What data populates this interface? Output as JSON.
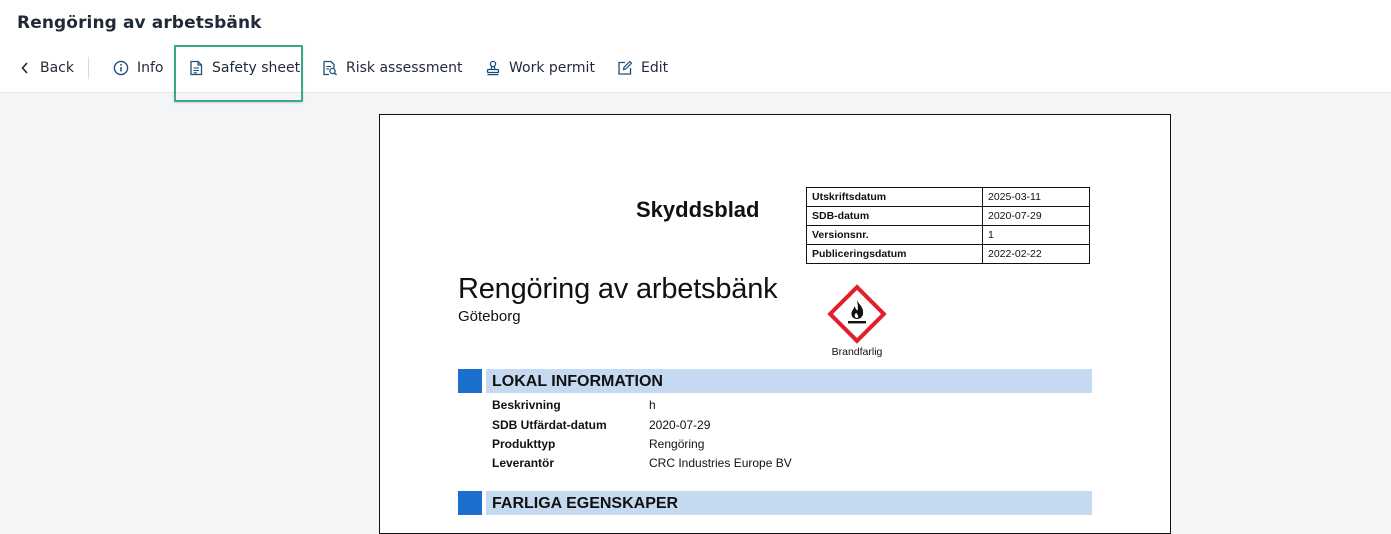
{
  "page": {
    "title": "Rengöring av arbetsbänk"
  },
  "toolbar": {
    "back": "Back",
    "info": "Info",
    "safety_sheet": "Safety sheet",
    "risk_assessment": "Risk assessment",
    "work_permit": "Work permit",
    "edit": "Edit",
    "active": "safety_sheet",
    "focus_color": "#3aa888"
  },
  "icons": {
    "back": "chevron-left-icon",
    "info": "info-circle-icon",
    "safety_sheet": "document-icon",
    "risk_assessment": "document-search-icon",
    "work_permit": "stamp-icon",
    "edit": "edit-icon",
    "hazard": "flammable-hazard-icon"
  },
  "document": {
    "heading": "Skyddsblad",
    "meta": [
      {
        "label": "Utskriftsdatum",
        "value": "2025-03-11"
      },
      {
        "label": "SDB-datum",
        "value": "2020-07-29"
      },
      {
        "label": "Versionsnr.",
        "value": "1"
      },
      {
        "label": "Publiceringsdatum",
        "value": "2022-02-22"
      }
    ],
    "product_name": "Rengöring av arbetsbänk",
    "location": "Göteborg",
    "hazard_label": "Brandfarlig",
    "hazard_color": "#e0202a",
    "section_color": "#1d6fce",
    "section_bar_color": "#c5daf1",
    "sections": [
      {
        "title": "LOKAL INFORMATION",
        "rows": [
          {
            "label": "Beskrivning",
            "value": "h"
          },
          {
            "label": "SDB Utfärdat-datum",
            "value": "2020-07-29"
          },
          {
            "label": "Produkttyp",
            "value": "Rengöring"
          },
          {
            "label": "Leverantör",
            "value": "CRC Industries Europe BV"
          }
        ]
      },
      {
        "title": "FARLIGA EGENSKAPER",
        "rows": []
      }
    ]
  }
}
